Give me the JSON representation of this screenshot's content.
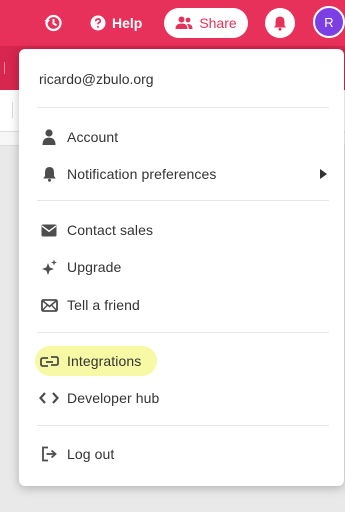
{
  "topbar": {
    "help_label": "Help",
    "share_label": "Share",
    "avatar_initial": "R",
    "icons": [
      "history-icon",
      "help-icon",
      "share-people-icon",
      "bell-icon"
    ],
    "colors": {
      "brand": "#e8315a",
      "avatar": "#7b3fe4"
    }
  },
  "menu": {
    "email": "ricardo@zbulo.org",
    "items": [
      {
        "label": "Account",
        "icon": "user-icon"
      },
      {
        "label": "Notification preferences",
        "icon": "bell-icon",
        "has_submenu": true
      },
      {
        "label": "Contact sales",
        "icon": "envelope-icon"
      },
      {
        "label": "Upgrade",
        "icon": "sparkle-icon"
      },
      {
        "label": "Tell a friend",
        "icon": "mail-outline-icon"
      },
      {
        "label": "Integrations",
        "icon": "integrations-link-icon",
        "highlighted": true
      },
      {
        "label": "Developer hub",
        "icon": "code-icon"
      },
      {
        "label": "Log out",
        "icon": "logout-icon"
      }
    ]
  }
}
